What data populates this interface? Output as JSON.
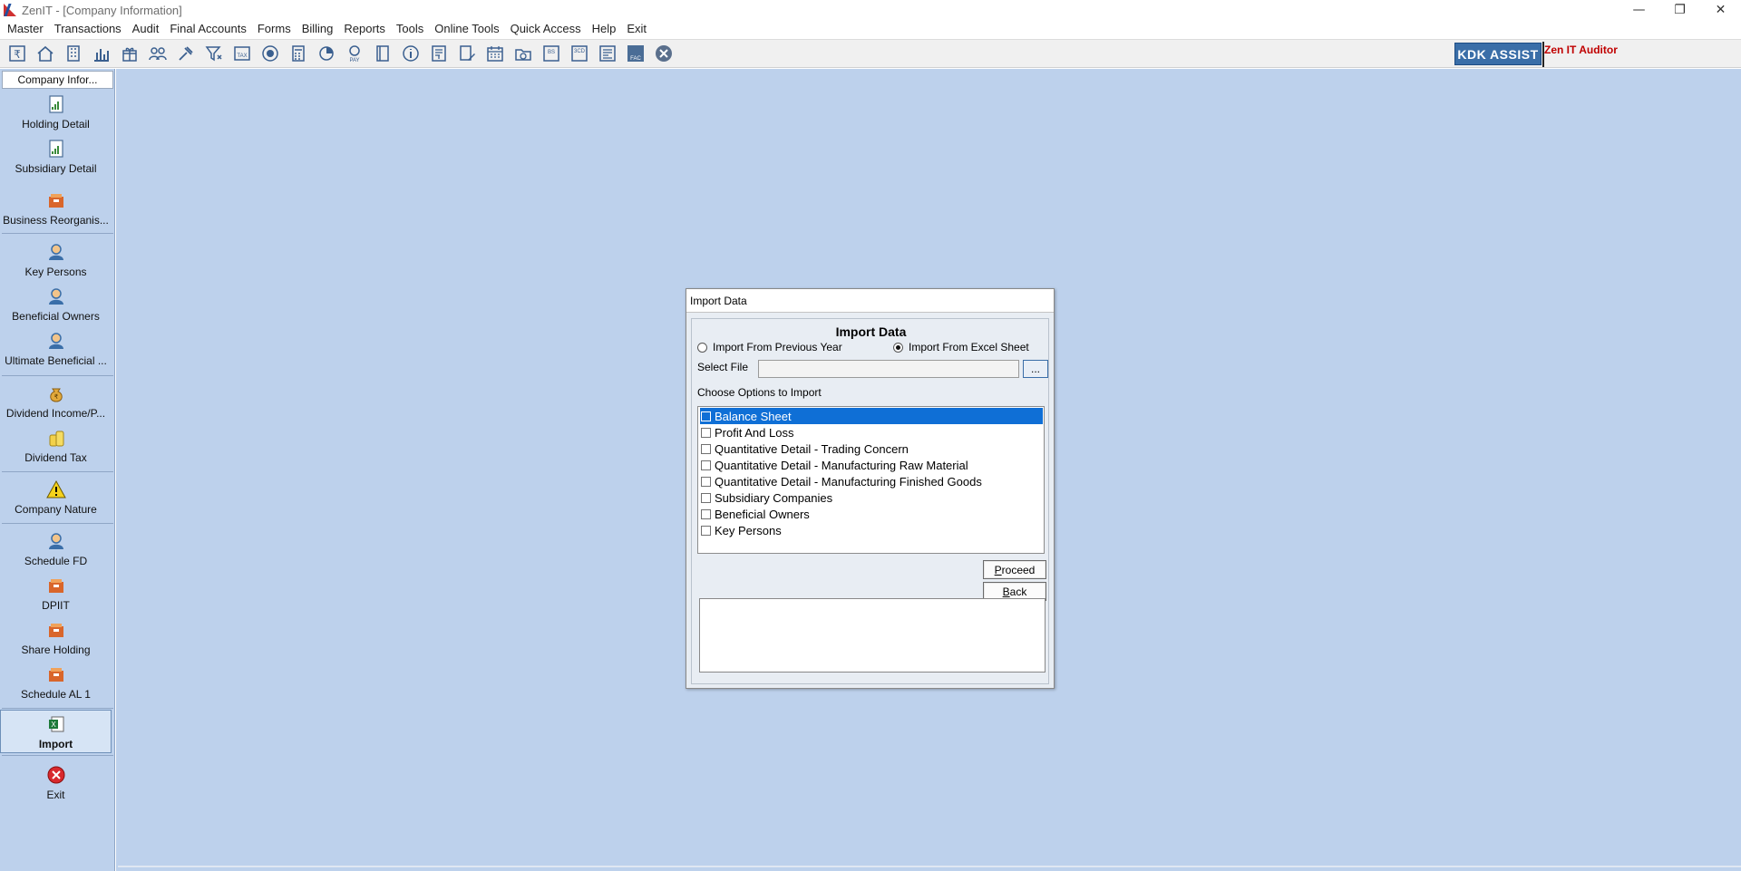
{
  "window": {
    "title": "ZenIT - [Company Information]",
    "controls": {
      "minimize": "—",
      "restore": "❐",
      "close": "✕"
    }
  },
  "menu": [
    "Master",
    "Transactions",
    "Audit",
    "Final Accounts",
    "Forms",
    "Billing",
    "Reports",
    "Tools",
    "Online Tools",
    "Quick Access",
    "Help",
    "Exit"
  ],
  "toolbar": {
    "icons": [
      "rupee-icon",
      "home-icon",
      "building-icon",
      "bar-chart-icon",
      "gift-icon",
      "users-icon",
      "hammer-icon",
      "funnel-icon",
      "tax-icon",
      "eye-icon",
      "calculator-icon",
      "pie-chart-icon",
      "pay-icon",
      "book-icon",
      "info-icon",
      "ledger-icon",
      "edit-doc-icon",
      "calendar-icon",
      "folder-add-icon",
      "balance-sheet-icon",
      "three-cd-icon",
      "report-icon",
      "fac-icon",
      "close-circle-icon"
    ],
    "tax_text": "TAX",
    "pay_text": "PAY",
    "bs_text": "BS",
    "cd_text": "3CD",
    "fac_text": "FAC",
    "kdk_label": "KDK ASSIST",
    "auditor_label": "Zen IT Auditor"
  },
  "sidebar": {
    "header": "Company Infor...",
    "items": [
      {
        "label": "Holding Detail",
        "icon": "report-doc-icon"
      },
      {
        "label": "Subsidiary Detail",
        "icon": "report-doc-icon"
      },
      {
        "label": "Business Reorganis...",
        "icon": "box-icon"
      },
      {
        "label": "Key Persons",
        "icon": "person-icon"
      },
      {
        "label": "Beneficial Owners",
        "icon": "person-icon"
      },
      {
        "label": "Ultimate Beneficial ...",
        "icon": "person-icon"
      },
      {
        "label": "Dividend Income/P...",
        "icon": "money-bag-icon"
      },
      {
        "label": "Dividend Tax",
        "icon": "coins-icon"
      },
      {
        "label": "Company Nature",
        "icon": "warning-icon"
      },
      {
        "label": "Schedule FD",
        "icon": "person-icon"
      },
      {
        "label": "DPIIT",
        "icon": "box-icon"
      },
      {
        "label": "Share Holding",
        "icon": "box-icon"
      },
      {
        "label": "Schedule AL 1",
        "icon": "box-icon"
      },
      {
        "label": "Import",
        "icon": "excel-icon"
      },
      {
        "label": "Exit",
        "icon": "exit-icon"
      }
    ]
  },
  "dialog": {
    "title": "Import Data",
    "heading": "Import Data",
    "radio_previous": "Import From Previous Year",
    "radio_excel": "Import From Excel Sheet",
    "selected_source": "excel",
    "select_file_label": "Select File",
    "file_value": "",
    "browse_label": "...",
    "options_label": "Choose Options to Import",
    "options": [
      "Balance Sheet",
      "Profit And Loss",
      "Quantitative Detail - Trading Concern",
      "Quantitative Detail - Manufacturing Raw Material",
      "Quantitative Detail - Manufacturing Finished Goods",
      "Subsidiary Companies",
      "Beneficial Owners",
      "Key Persons"
    ],
    "selected_option": "Balance Sheet",
    "proceed_label": "Proceed",
    "proceed_mnemonic": "P",
    "proceed_rest": "roceed",
    "back_mnemonic": "B",
    "back_rest": "ack",
    "log_text": ""
  },
  "colors": {
    "workspace": "#bdd1ec",
    "selection": "#0f6fd6",
    "kdk_badge": "#3a6ea8",
    "auditor_text": "#c00000"
  }
}
